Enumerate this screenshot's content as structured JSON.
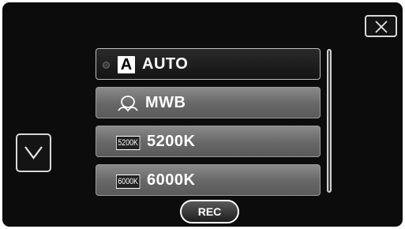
{
  "items": [
    {
      "label": "AUTO",
      "icon": "auto-icon",
      "glyph": "A",
      "selected": true
    },
    {
      "label": "MWB",
      "icon": "manual-white-balance-icon",
      "selected": false
    },
    {
      "label": "5200K",
      "icon": "5200k-icon",
      "badge": "5200K",
      "selected": false
    },
    {
      "label": "6000K",
      "icon": "6000k-icon",
      "badge": "6000K",
      "selected": false
    }
  ],
  "rec_label": "REC",
  "icons": {
    "close": "close-icon",
    "down": "chevron-down-icon"
  },
  "colors": {
    "background": "#0c0c0c",
    "selected_item": "#141414",
    "item": "#6e6e6e",
    "text": "#ffffff"
  }
}
